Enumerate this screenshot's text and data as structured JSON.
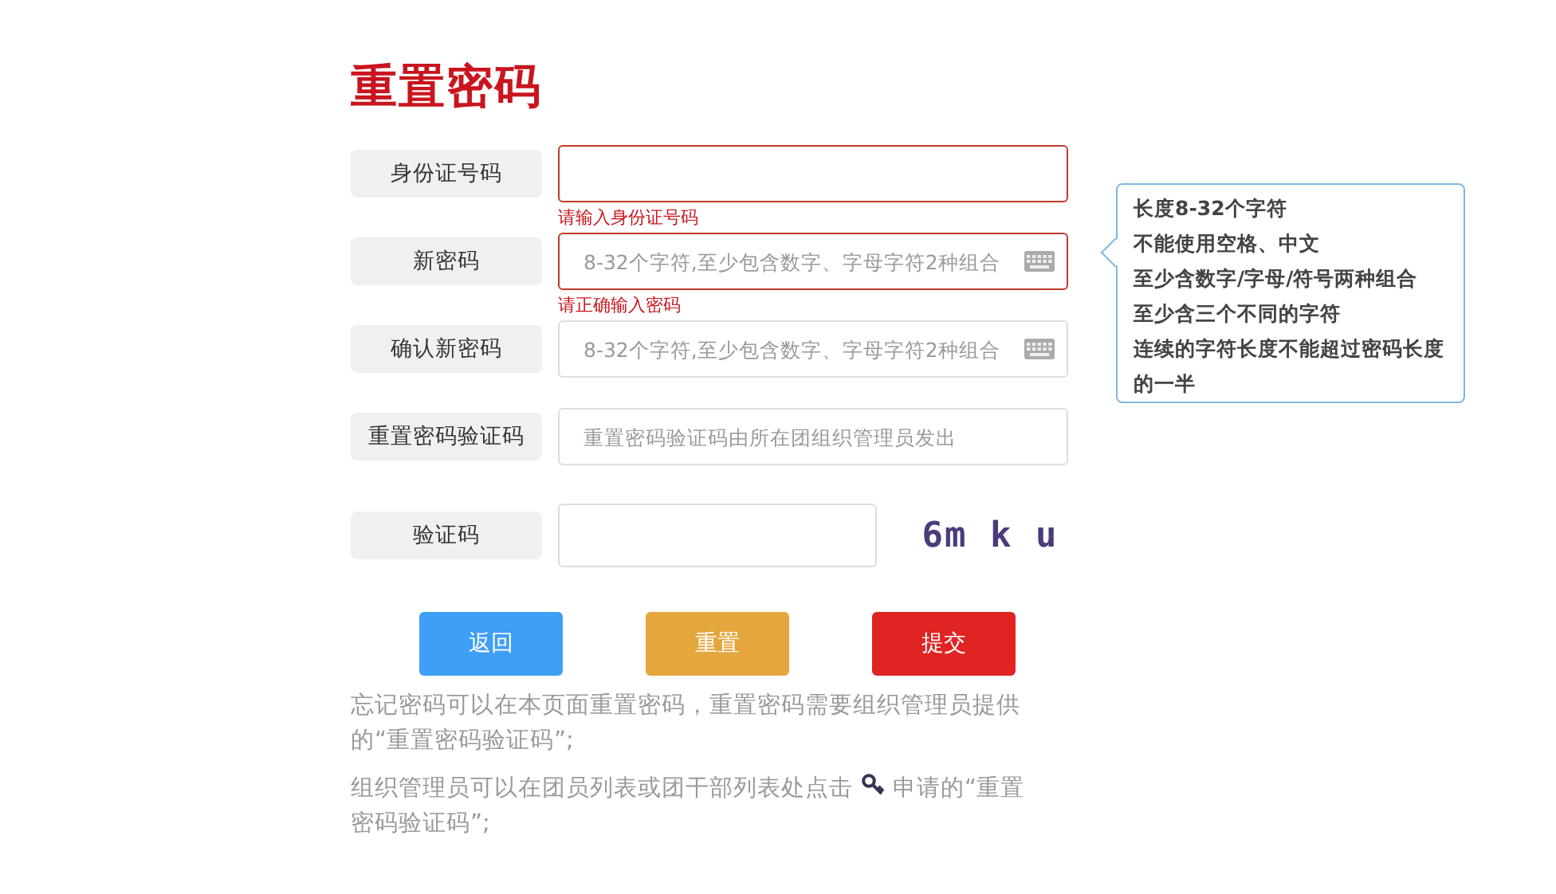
{
  "title": "重置密码",
  "fields": [
    {
      "label": "身份证号码",
      "kind": "text",
      "error": true,
      "message": "请输入身份证号码"
    },
    {
      "label": "新密码",
      "kind": "password",
      "placeholder": "8-32个字符,至少包含数字、字母字符2种组合",
      "error": true,
      "message": "请正确输入密码"
    },
    {
      "label": "确认新密码",
      "kind": "password",
      "placeholder": "8-32个字符,至少包含数字、字母字符2种组合",
      "error": false
    },
    {
      "label": "重置密码验证码",
      "kind": "text",
      "placeholder": "重置密码验证码由所在团组织管理员发出",
      "error": false
    },
    {
      "label": "验证码",
      "kind": "captcha",
      "error": false,
      "captcha": "6m k u"
    }
  ],
  "tooltip": [
    "长度8-32个字符",
    "不能使用空格、中文",
    "至少含数字/字母/符号两种组合",
    "至少含三个不同的字符",
    "连续的字符长度不能超过密码长度的一半"
  ],
  "buttons": [
    {
      "label": "返回",
      "color": "#3f9ff4"
    },
    {
      "label": "重置",
      "color": "#e4a63d"
    },
    {
      "label": "提交",
      "color": "#e02423"
    }
  ],
  "notes": [
    {
      "before": "忘记密码可以在本页面重置密码，重置密码需要组织管理员提供的“重置密码验证码”;"
    },
    {
      "kind": "with-icon",
      "before": "组织管理员可以在团员列表或团干部列表处点击",
      "after": "申请的“重置",
      "continued": "密码验证码”;"
    }
  ]
}
